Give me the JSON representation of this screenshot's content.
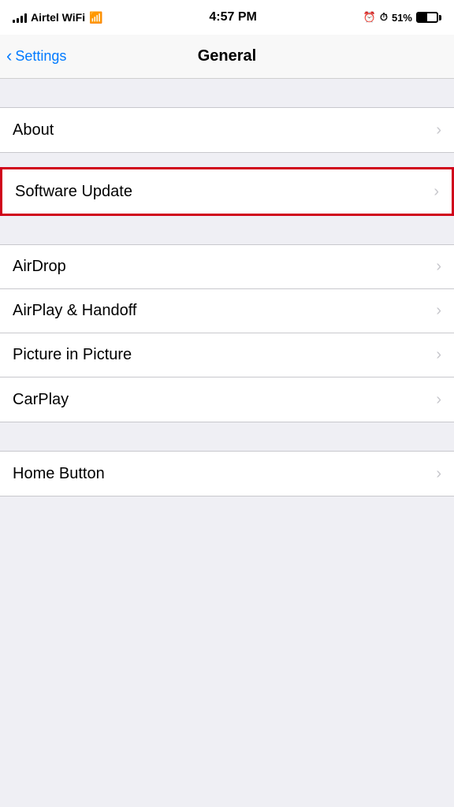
{
  "status_bar": {
    "carrier": "Airtel WiFi",
    "time": "4:57 PM",
    "battery_percent": "51%",
    "icons": {
      "alarm": "⏰",
      "clock": "🕐"
    }
  },
  "nav": {
    "back_label": "Settings",
    "title": "General"
  },
  "sections": {
    "group1": {
      "items": [
        {
          "label": "About"
        }
      ]
    },
    "group2_highlighted": {
      "items": [
        {
          "label": "Software Update"
        }
      ]
    },
    "group3": {
      "items": [
        {
          "label": "AirDrop"
        },
        {
          "label": "AirPlay & Handoff"
        },
        {
          "label": "Picture in Picture"
        },
        {
          "label": "CarPlay"
        }
      ]
    },
    "group4": {
      "items": [
        {
          "label": "Home Button"
        }
      ]
    }
  }
}
